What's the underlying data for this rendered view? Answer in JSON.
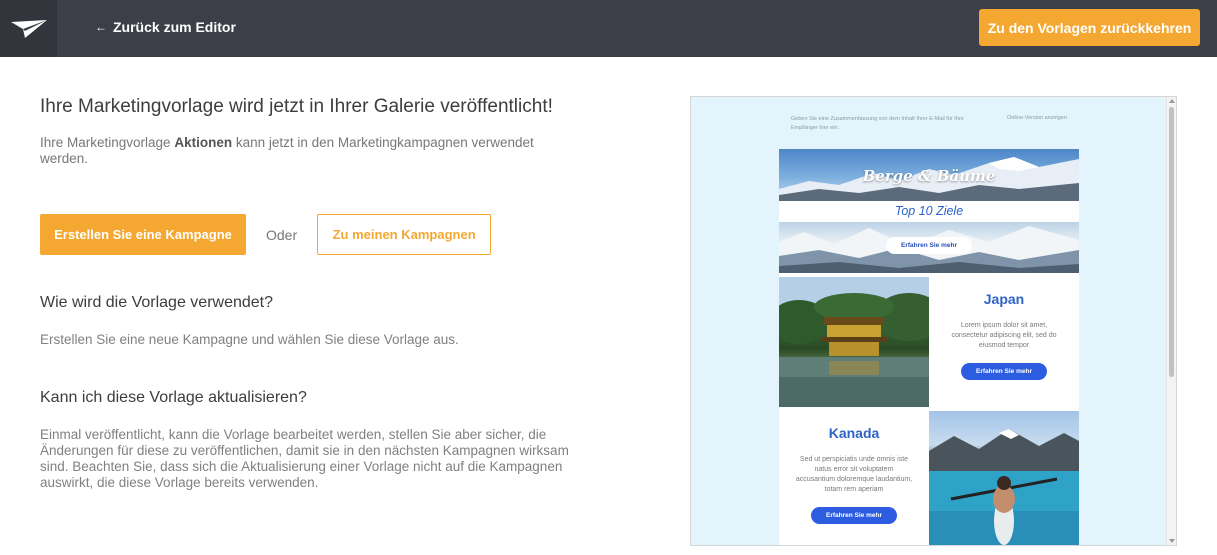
{
  "topbar": {
    "back_label": "Zurück zum Editor",
    "return_label": "Zu den Vorlagen zurückkehren"
  },
  "main": {
    "heading": "Ihre Marketingvorlage wird jetzt in Ihrer Galerie veröffentlicht!",
    "intro_prefix": "Ihre Marketingvorlage ",
    "intro_name": "Aktionen",
    "intro_suffix": " kann jetzt in den Marketingkampagnen verwendet werden.",
    "create_campaign_label": "Erstellen Sie eine Kampagne",
    "or_label": "Oder",
    "my_campaigns_label": "Zu meinen Kampagnen",
    "section1_title": "Wie wird die Vorlage verwendet?",
    "section1_text": "Erstellen Sie eine neue Kampagne und wählen Sie diese Vorlage aus.",
    "section2_title": "Kann ich diese Vorlage aktualisieren?",
    "section2_text": "Einmal veröffentlicht, kann die Vorlage bearbeitet werden, stellen Sie aber sicher, die Änderungen für diese zu veröffentlichen, damit sie in den nächsten Kampagnen wirksam sind. Beachten Sie, dass sich die Aktualisierung einer Vorlage nicht auf die Kampagnen auswirkt, die diese Vorlage bereits verwenden."
  },
  "preview": {
    "summary": "Geben Sie eine Zusammenfassung von dem Inhalt Ihrer E-Mail für Ihre Empfänger hier ein.",
    "online_version": "Online-Version anzeigen",
    "hero_title": "Berge & Bäume",
    "hero_subtitle": "Top 10 Ziele",
    "hero_button": "Erfahren Sie mehr",
    "japan": {
      "title": "Japan",
      "body": "Lorem ipsum dolor sit amet, consectetur adipiscing elit, sed do eiusmod tempor",
      "button": "Erfahren Sie mehr"
    },
    "kanada": {
      "title": "Kanada",
      "body": "Sed ut perspiciatis unde omnis iste natus error sit voluptatem accusantium doloremque laudantium, totam rem aperiam",
      "button": "Erfahren Sie mehr"
    }
  },
  "colors": {
    "accent": "#f4a731",
    "topbar": "#3c3f47",
    "preview_bg": "#e3f4fd",
    "link_blue": "#2d63c8"
  }
}
